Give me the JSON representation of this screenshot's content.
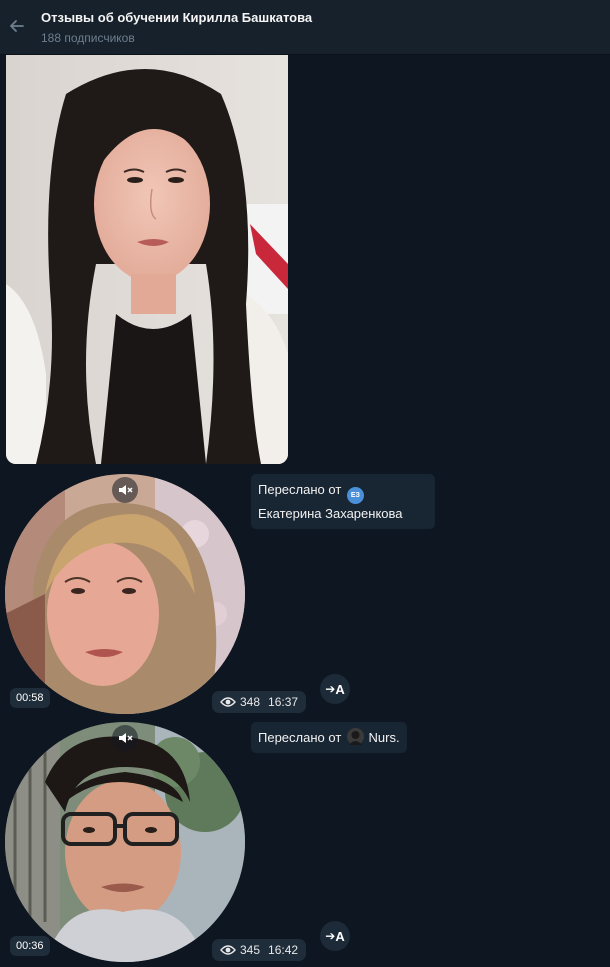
{
  "header": {
    "title": "Отзывы об обучении Кирилла Башкатова",
    "subscribers": "188 подписчиков"
  },
  "messages": [
    {
      "forward_prefix": "Переслано от",
      "author": "Екатерина Захаренкова",
      "author_initials": "ЕЗ",
      "duration": "00:58",
      "views": "348",
      "time": "16:37",
      "translate_label": "A"
    },
    {
      "forward_prefix": "Переслано от",
      "author": "Nurs.",
      "duration": "00:36",
      "views": "345",
      "time": "16:42",
      "translate_label": "A"
    }
  ],
  "colors": {
    "background": "#0e1621",
    "header": "#17212b",
    "bubble": "#182533",
    "avatar_ez": "#4a90d9",
    "muted_text": "#6d7f8f"
  }
}
